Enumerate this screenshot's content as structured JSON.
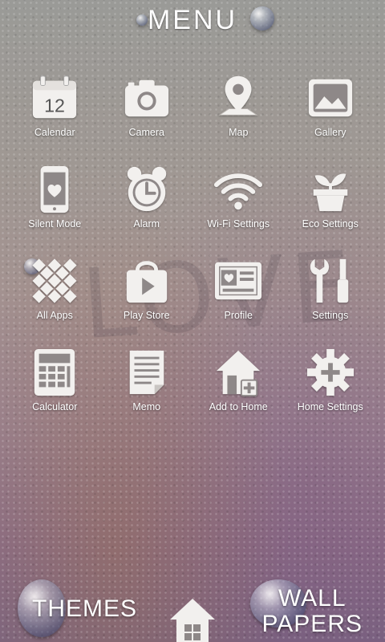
{
  "title": "MENU",
  "rows": [
    [
      {
        "label": "Calendar",
        "icon": "calendar-icon",
        "day": "12"
      },
      {
        "label": "Camera",
        "icon": "camera-icon"
      },
      {
        "label": "Map",
        "icon": "map-pin-icon"
      },
      {
        "label": "Gallery",
        "icon": "gallery-icon"
      }
    ],
    [
      {
        "label": "Silent Mode",
        "icon": "silent-mode-icon"
      },
      {
        "label": "Alarm",
        "icon": "alarm-clock-icon"
      },
      {
        "label": "Wi-Fi Settings",
        "icon": "wifi-icon"
      },
      {
        "label": "Eco Settings",
        "icon": "plant-pot-icon"
      }
    ],
    [
      {
        "label": "All Apps",
        "icon": "all-apps-icon"
      },
      {
        "label": "Play Store",
        "icon": "play-store-icon"
      },
      {
        "label": "Profile",
        "icon": "profile-card-icon"
      },
      {
        "label": "Settings",
        "icon": "tools-icon"
      }
    ],
    [
      {
        "label": "Calculator",
        "icon": "calculator-icon"
      },
      {
        "label": "Memo",
        "icon": "memo-icon"
      },
      {
        "label": "Add to Home",
        "icon": "add-to-home-icon"
      },
      {
        "label": "Home Settings",
        "icon": "gear-icon"
      }
    ]
  ],
  "bottom": {
    "themes_label": "THEMES",
    "wall_line1": "WALL",
    "wall_line2": "PAPERS",
    "home_icon": "home-icon"
  },
  "background_word": "LOVE",
  "colors": {
    "icon": "#f2f0ee",
    "text": "#ffffff"
  }
}
